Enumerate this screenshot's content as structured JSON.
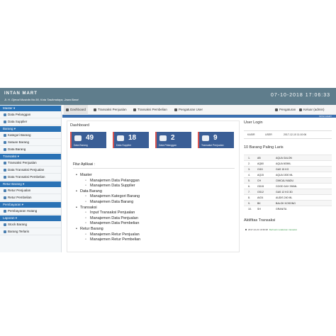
{
  "app": {
    "title": "INTAN MART",
    "address": "Jl. H. Djenal Mustofa No.56, Kota Tasikmalaya, Jawa Barat",
    "clock": "07-10-2018 17:06:33"
  },
  "sidebar": {
    "groups": [
      {
        "label": "Master ▾",
        "items": [
          "Data Pelanggan",
          "Data Supplier"
        ]
      },
      {
        "label": "Barang ▾",
        "items": [
          "Kategori Barang",
          "Satuan Barang",
          "Data Barang"
        ]
      },
      {
        "label": "Transaksi ▾",
        "items": [
          "Transaksi Penjualan",
          "Data Transaksi Penjualan",
          "Data Transaksi Pembelian"
        ]
      },
      {
        "label": "Retur Barang ▾",
        "items": [
          "Retur Penjualan",
          "Retur Pembelian"
        ]
      },
      {
        "label": "Pembayaran ▾",
        "items": [
          "Pembayaran Hutang"
        ]
      },
      {
        "label": "Laporan ▾",
        "items": [
          "Stock Barang",
          "Barang Terlaris"
        ]
      }
    ]
  },
  "navbar": {
    "dashboard": "Dashboard",
    "transaksi_penjualan": "Transaksi Penjualan",
    "transaksi_pembelian": "Transaksi Pembelian",
    "pengaturan_user": "Pengaturan User",
    "pengaturan": "Pengaturan",
    "keluar": "Keluar (admin)"
  },
  "strip_label": "INTAN MART",
  "dashboard": {
    "title": "Dashboard",
    "stats": [
      {
        "value": "49",
        "label": "Data Barang"
      },
      {
        "value": "18",
        "label": "Data Supplier"
      },
      {
        "value": "2",
        "label": "Data Pelanggan"
      },
      {
        "value": "9",
        "label": "Transaksi Penjualan"
      }
    ],
    "fitur_title": "Fitur Aplikasi :",
    "fitur": [
      {
        "level": 1,
        "text": "Master"
      },
      {
        "level": 2,
        "text": "Manajemen Data Pelanggan"
      },
      {
        "level": 2,
        "text": "Manajemen Data Supplier"
      },
      {
        "level": 1,
        "text": "Data Barang"
      },
      {
        "level": 2,
        "text": "Manajemen Kategori Barang"
      },
      {
        "level": 2,
        "text": "Manajemen Data Barang"
      },
      {
        "level": 1,
        "text": "Transaksi"
      },
      {
        "level": 2,
        "text": "Input Transaksi Penjualan"
      },
      {
        "level": 2,
        "text": "Manajemen Data Penjualan"
      },
      {
        "level": 2,
        "text": "Manajemen Data Pembelian"
      },
      {
        "level": 1,
        "text": "Retur Barang"
      },
      {
        "level": 2,
        "text": "Manajemen Retur Penjualan"
      },
      {
        "level": 2,
        "text": "Manajemen Retur Pembelian"
      }
    ]
  },
  "user_login": {
    "title": "User Login",
    "role": "KASIR",
    "username": "USER",
    "time": "2017-12-10 11:10:06"
  },
  "top_items": {
    "title": "10 Barang Paling Laris",
    "rows": [
      {
        "no": "1.",
        "code": "AB",
        "name": "AQUA GALON"
      },
      {
        "no": "2.",
        "code": "AQ60",
        "name": "AQUA 600ML"
      },
      {
        "no": "3.",
        "code": "GI15",
        "name": "GAS 15 KG"
      },
      {
        "no": "4.",
        "code": "AQ15",
        "name": "AQUA 1500 ML"
      },
      {
        "no": "5.",
        "code": "CH",
        "name": "CIMCAU MADU"
      },
      {
        "no": "6.",
        "code": "GD15",
        "name": "GOOD DAY 250ML"
      },
      {
        "no": "7.",
        "code": "GS12",
        "name": "GAS 12 KG 3D"
      },
      {
        "no": "8.",
        "code": "AV24",
        "name": "AUDIS 240 ML"
      },
      {
        "no": "9.",
        "code": "BK",
        "name": "BALOK KOSONG"
      },
      {
        "no": "10.",
        "code": "SH",
        "name": "GRANITA"
      }
    ]
  },
  "activity": {
    "title": "Aktifitas Transaksi",
    "time": "2017-12-21 10:36:38",
    "message": "Berhasil melakukan transaksi"
  }
}
